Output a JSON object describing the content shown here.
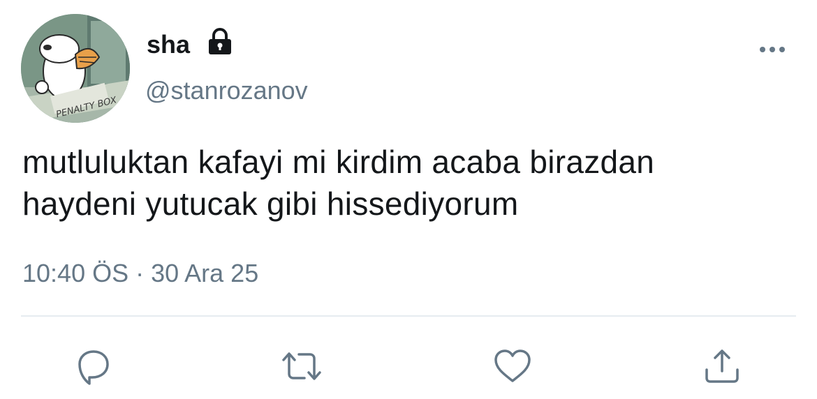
{
  "user": {
    "display_name": "sha",
    "handle": "@stanrozanov",
    "avatar_caption": "PENALTY BOX",
    "protected_icon": "lock-icon"
  },
  "tweet": {
    "text_line_1": "mutluluktan kafayi mi kirdim acaba birazdan",
    "text_line_2": "haydeni yutucak gibi hissediyorum",
    "timestamp": "10:40 ÖS · 30 Ara 25"
  },
  "actions": [
    {
      "name": "reply",
      "icon": "speech-bubble-icon"
    },
    {
      "name": "retweet",
      "icon": "retweet-icon"
    },
    {
      "name": "like",
      "icon": "heart-icon"
    },
    {
      "name": "share",
      "icon": "share-icon"
    }
  ],
  "colors": {
    "text_primary": "#14171a",
    "text_secondary": "#657786",
    "divider": "#e6ecf0"
  }
}
